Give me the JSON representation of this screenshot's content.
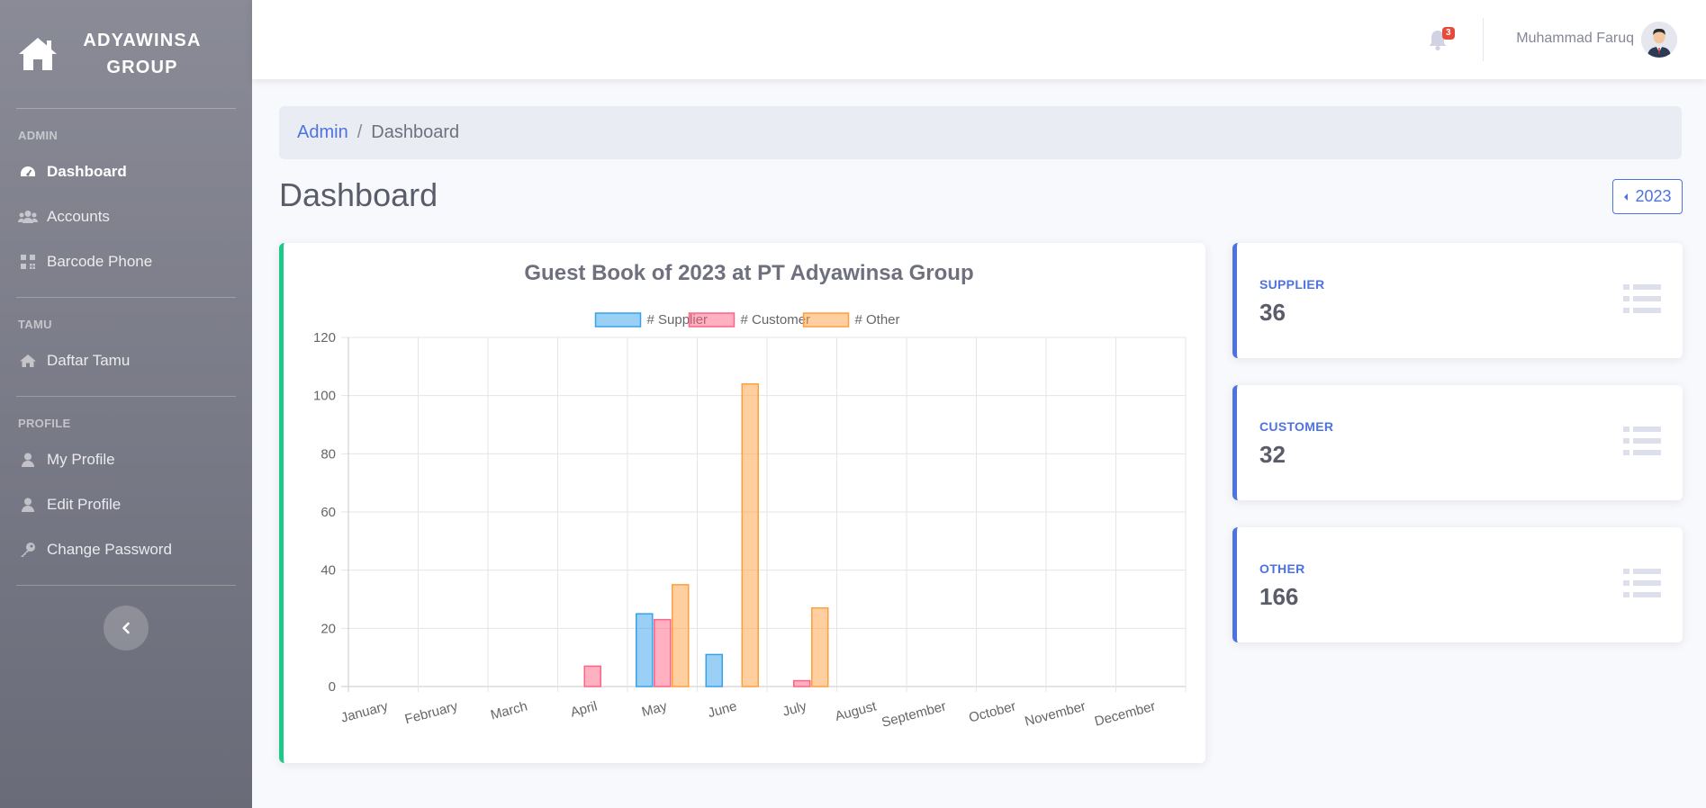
{
  "brand": {
    "line1": "ADYAWINSA",
    "line2": "GROUP"
  },
  "sidebar": {
    "sections": [
      {
        "heading": "ADMIN",
        "items": [
          {
            "label": "Dashboard",
            "icon": "tachometer-icon",
            "active": true
          },
          {
            "label": "Accounts",
            "icon": "users-icon"
          },
          {
            "label": "Barcode Phone",
            "icon": "qrcode-icon"
          }
        ]
      },
      {
        "heading": "TAMU",
        "items": [
          {
            "label": "Daftar Tamu",
            "icon": "home-icon"
          }
        ]
      },
      {
        "heading": "PROFILE",
        "items": [
          {
            "label": "My Profile",
            "icon": "user-icon"
          },
          {
            "label": "Edit Profile",
            "icon": "user-edit-icon"
          },
          {
            "label": "Change Password",
            "icon": "key-icon"
          }
        ]
      }
    ]
  },
  "topbar": {
    "notification_count": "3",
    "user_name": "Muhammad Faruq"
  },
  "breadcrumb": {
    "parent": "Admin",
    "current": "Dashboard"
  },
  "page": {
    "title": "Dashboard",
    "year_button": "2023"
  },
  "stats": [
    {
      "label": "SUPPLIER",
      "value": "36"
    },
    {
      "label": "CUSTOMER",
      "value": "32"
    },
    {
      "label": "OTHER",
      "value": "166"
    }
  ],
  "colors": {
    "primary": "#4e73df",
    "success": "#1cc88a",
    "danger": "#e74a3b"
  },
  "chart_data": {
    "type": "bar",
    "title": "Guest Book of 2023 at PT Adyawinsa Group",
    "categories": [
      "January",
      "February",
      "March",
      "April",
      "May",
      "June",
      "July",
      "August",
      "September",
      "October",
      "November",
      "December"
    ],
    "series": [
      {
        "name": "# Supplier",
        "values": [
          0,
          0,
          0,
          0,
          25,
          11,
          0,
          0,
          0,
          0,
          0,
          0
        ],
        "fill": "rgba(54,162,235,0.5)",
        "stroke": "#36a2eb"
      },
      {
        "name": "# Customer",
        "values": [
          0,
          0,
          0,
          7,
          23,
          0,
          2,
          0,
          0,
          0,
          0,
          0
        ],
        "fill": "rgba(255,99,132,0.5)",
        "stroke": "#ff6384"
      },
      {
        "name": "# Other",
        "values": [
          0,
          0,
          0,
          0,
          35,
          104,
          27,
          0,
          0,
          0,
          0,
          0
        ],
        "fill": "rgba(255,159,64,0.5)",
        "stroke": "#ff9f40"
      }
    ],
    "ylim": [
      0,
      120
    ],
    "yticks": [
      0,
      20,
      40,
      60,
      80,
      100,
      120
    ],
    "legend": "top",
    "grid": true
  }
}
